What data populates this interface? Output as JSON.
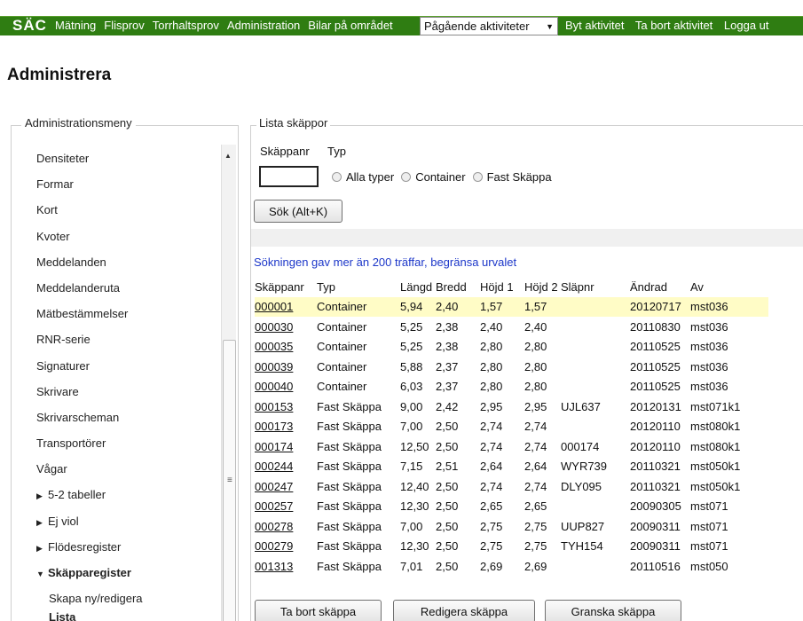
{
  "header": {
    "logo": "SÄC",
    "nav": [
      "Mätning",
      "Flisprov",
      "Torrhaltsprov",
      "Administration",
      "Bilar på området"
    ],
    "activity_select": "Pågående aktiviteter",
    "nav_right": [
      "Byt aktivitet",
      "Ta bort aktivitet",
      "Logga ut"
    ],
    "nav_color": "#2f7d12"
  },
  "page": {
    "title": "Administrera"
  },
  "sidebar": {
    "legend": "Administrationsmeny",
    "items": [
      "Densiteter",
      "Formar",
      "Kort",
      "Kvoter",
      "Meddelanden",
      "Meddelanderuta",
      "Mätbestämmelser",
      "RNR-serie",
      "Signaturer",
      "Skrivare",
      "Skrivarscheman",
      "Transportörer",
      "Vågar"
    ],
    "groups": [
      "5-2 tabeller",
      "Ej viol",
      "Flödesregister"
    ],
    "open_group": "Skäpparegister",
    "children": [
      "Skapa ny/redigera",
      "Lista"
    ]
  },
  "panel": {
    "legend": "Lista skäppor",
    "label_nr": "Skäppanr",
    "label_typ": "Typ",
    "input_value": "",
    "radio_options": [
      "Alla typer",
      "Container",
      "Fast Skäppa"
    ],
    "search_button": "Sök (Alt+K)",
    "warning": "Sökningen gav mer än 200 träffar, begränsa urvalet",
    "warning_color": "#1b36c9",
    "columns": [
      "Skäppanr",
      "Typ",
      "Längd",
      "Bredd",
      "Höjd 1",
      "Höjd 2",
      "Släpnr",
      "Ändrad",
      "Av"
    ],
    "rows": [
      [
        "000001",
        "Container",
        "5,94",
        "2,40",
        "1,57",
        "1,57",
        "",
        "20120717",
        "mst036"
      ],
      [
        "000030",
        "Container",
        "5,25",
        "2,38",
        "2,40",
        "2,40",
        "",
        "20110830",
        "mst036"
      ],
      [
        "000035",
        "Container",
        "5,25",
        "2,38",
        "2,80",
        "2,80",
        "",
        "20110525",
        "mst036"
      ],
      [
        "000039",
        "Container",
        "5,88",
        "2,37",
        "2,80",
        "2,80",
        "",
        "20110525",
        "mst036"
      ],
      [
        "000040",
        "Container",
        "6,03",
        "2,37",
        "2,80",
        "2,80",
        "",
        "20110525",
        "mst036"
      ],
      [
        "000153",
        "Fast Skäppa",
        "9,00",
        "2,42",
        "2,95",
        "2,95",
        "UJL637",
        "20120131",
        "mst071k1"
      ],
      [
        "000173",
        "Fast Skäppa",
        "7,00",
        "2,50",
        "2,74",
        "2,74",
        "",
        "20120110",
        "mst080k1"
      ],
      [
        "000174",
        "Fast Skäppa",
        "12,50",
        "2,50",
        "2,74",
        "2,74",
        "000174",
        "20120110",
        "mst080k1"
      ],
      [
        "000244",
        "Fast Skäppa",
        "7,15",
        "2,51",
        "2,64",
        "2,64",
        "WYR739",
        "20110321",
        "mst050k1"
      ],
      [
        "000247",
        "Fast Skäppa",
        "12,40",
        "2,50",
        "2,74",
        "2,74",
        "DLY095",
        "20110321",
        "mst050k1"
      ],
      [
        "000257",
        "Fast Skäppa",
        "12,30",
        "2,50",
        "2,65",
        "2,65",
        "",
        "20090305",
        "mst071"
      ],
      [
        "000278",
        "Fast Skäppa",
        "7,00",
        "2,50",
        "2,75",
        "2,75",
        "UUP827",
        "20090311",
        "mst071"
      ],
      [
        "000279",
        "Fast Skäppa",
        "12,30",
        "2,50",
        "2,75",
        "2,75",
        "TYH154",
        "20090311",
        "mst071"
      ],
      [
        "001313",
        "Fast Skäppa",
        "7,01",
        "2,50",
        "2,69",
        "2,69",
        "",
        "20110516",
        "mst050"
      ]
    ],
    "highlight_color": "#fffcc6",
    "buttons": {
      "delete": "Ta bort skäppa",
      "edit": "Redigera skäppa",
      "view": "Granska skäppa"
    }
  }
}
